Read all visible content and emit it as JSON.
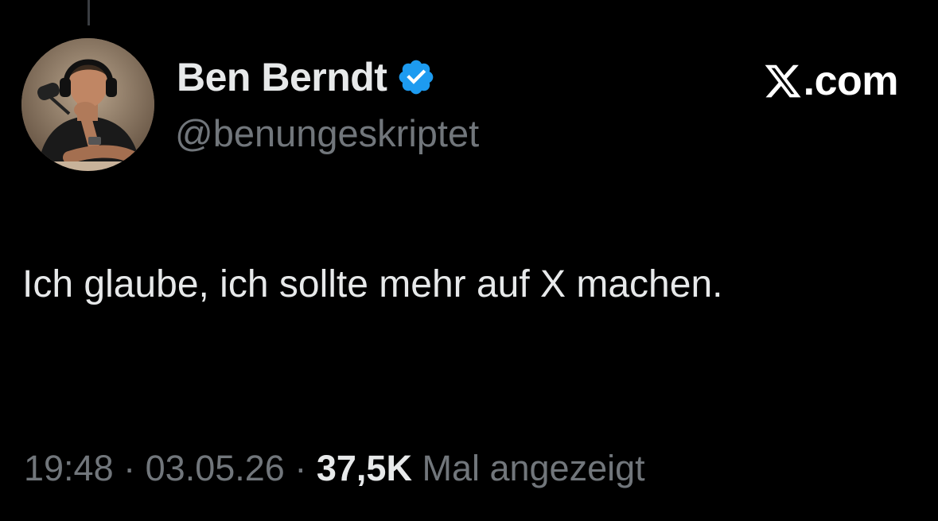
{
  "author": {
    "display_name": "Ben Berndt",
    "handle": "@benungeskriptet",
    "verified": true,
    "verified_color": "#1d9bf0"
  },
  "brand": {
    "logo_icon": "x-logo-icon",
    "suffix": ".com"
  },
  "tweet": {
    "text": "Ich glaube, ich sollte mehr auf X machen."
  },
  "meta": {
    "time": "19:48",
    "separator": "·",
    "date": "03.05.26",
    "views_count": "37,5K",
    "views_label": "Mal angezeigt"
  },
  "colors": {
    "background": "#000000",
    "primary_text": "#e7e9ea",
    "secondary_text": "#71767b"
  }
}
